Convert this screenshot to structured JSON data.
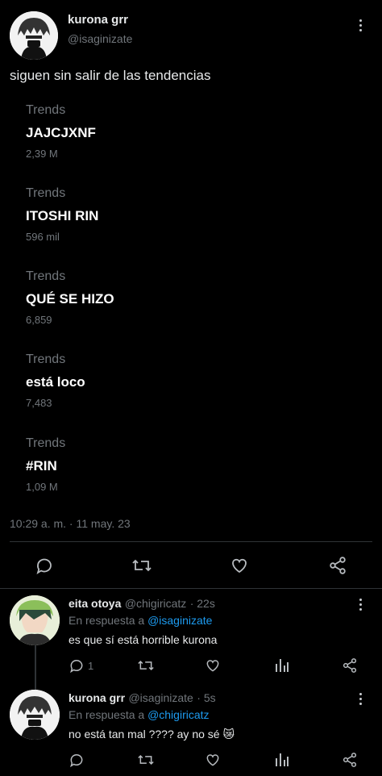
{
  "tweet": {
    "author_name": "kurona grr",
    "author_handle": "@isaginizate",
    "text": "siguen sin salir de las tendencias",
    "trends": [
      {
        "label": "Trends",
        "name": "JAJCJXNF",
        "count": "2,39 M"
      },
      {
        "label": "Trends",
        "name": "ITOSHI RIN",
        "count": "596 mil"
      },
      {
        "label": "Trends",
        "name": "QUÉ SE HIZO",
        "count": "6,859"
      },
      {
        "label": "Trends",
        "name": "está loco",
        "count": "7,483"
      },
      {
        "label": "Trends",
        "name": "#RIN",
        "count": "1,09 M"
      }
    ],
    "timestamp": "10:29 a. m. · 11 may. 23"
  },
  "replies": [
    {
      "author_name": "eita otoya",
      "author_handle": "@chigiricatz",
      "time": "· 22s",
      "reply_prefix": "En respuesta a",
      "reply_to": "@isaginizate",
      "text": "es que sí está horrible kurona",
      "reply_count": "1"
    },
    {
      "author_name": "kurona grr",
      "author_handle": "@isaginizate",
      "time": "· 5s",
      "reply_prefix": "En respuesta a",
      "reply_to": "@chigiricatz",
      "text": "no está tan mal ???? ay no sé 😿",
      "reply_count": ""
    }
  ],
  "colors": {
    "accent": "#1d9bf0",
    "background": "#000000",
    "muted": "#71767b"
  },
  "icons": [
    "more-icon",
    "reply-icon",
    "retweet-icon",
    "like-icon",
    "share-icon",
    "stats-icon"
  ]
}
